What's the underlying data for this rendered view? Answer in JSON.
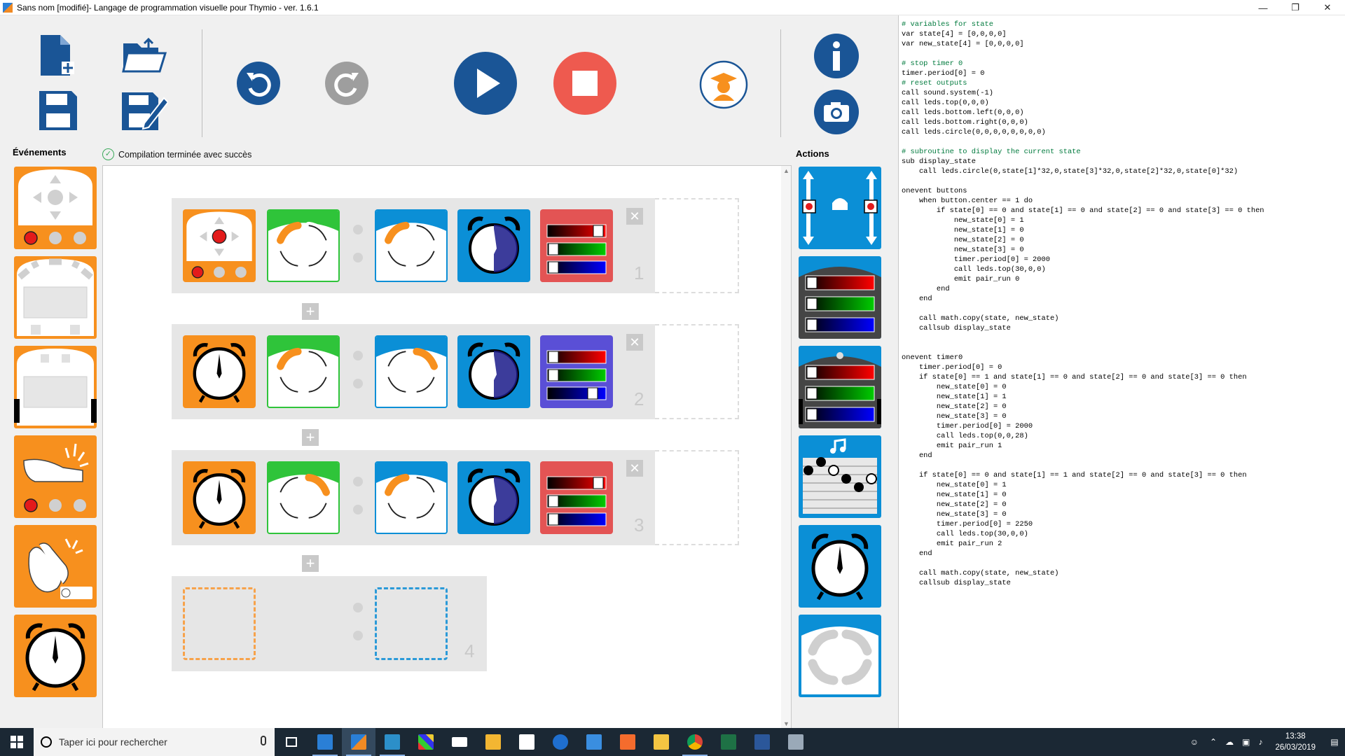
{
  "window": {
    "title": "Sans nom [modifié]- Langage de programmation visuelle pour Thymio - ver. 1.6.1",
    "controls": [
      "minimize",
      "maximize",
      "close"
    ]
  },
  "toolbar": {
    "buttons": [
      "new-file",
      "open-file",
      "save",
      "save-as",
      "undo",
      "redo",
      "run",
      "stop",
      "teacher-mode",
      "info",
      "screenshot"
    ],
    "colors": {
      "primary": "#1a5596",
      "stop": "#ee5a4f",
      "redo_disabled": "#9e9e9e",
      "teacher": "#f7901e"
    }
  },
  "events_label": "Événements",
  "actions_label": "Actions",
  "status_text": "Compilation terminée avec succès",
  "events": [
    "buttons-event",
    "front-proximity-event",
    "ground-proximity-event",
    "tap-event",
    "clap-event",
    "timer-event"
  ],
  "actions": [
    "motors-action",
    "top-color-action",
    "bottom-color-action",
    "music-action",
    "timer-action",
    "state-action"
  ],
  "rows": [
    {
      "number": "1",
      "event": "buttons",
      "state": [
        "on",
        "off",
        "off",
        "off"
      ],
      "new_state": [
        "on",
        "off",
        "off",
        "off"
      ],
      "color": "red"
    },
    {
      "number": "2",
      "event": "timer",
      "state": [
        "on",
        "off",
        "off",
        "off"
      ],
      "new_state": [
        "off",
        "on",
        "off",
        "off"
      ],
      "color": "blue"
    },
    {
      "number": "3",
      "event": "timer",
      "state": [
        "off",
        "on",
        "off",
        "off"
      ],
      "new_state": [
        "on",
        "off",
        "off",
        "off"
      ],
      "color": "red"
    },
    {
      "number": "4",
      "event": "empty"
    }
  ],
  "code_lines": [
    {
      "t": "# variables for state",
      "c": "com"
    },
    {
      "t": "var state[4] = [0,0,0,0]",
      "c": "kw"
    },
    {
      "t": "var new_state[4] = [0,0,0,0]",
      "c": "kw"
    },
    {
      "t": "",
      "c": ""
    },
    {
      "t": "# stop timer 0",
      "c": "com"
    },
    {
      "t": "timer.period[0] = 0",
      "c": ""
    },
    {
      "t": "# reset outputs",
      "c": "com"
    },
    {
      "t": "call sound.system(-1)",
      "c": "kw"
    },
    {
      "t": "call leds.top(0,0,0)",
      "c": "kw"
    },
    {
      "t": "call leds.bottom.left(0,0,0)",
      "c": "kw"
    },
    {
      "t": "call leds.bottom.right(0,0,0)",
      "c": "kw"
    },
    {
      "t": "call leds.circle(0,0,0,0,0,0,0,0)",
      "c": "kw"
    },
    {
      "t": "",
      "c": ""
    },
    {
      "t": "# subroutine to display the current state",
      "c": "com"
    },
    {
      "t": "sub display_state",
      "c": "kw"
    },
    {
      "t": "    call leds.circle(0,state[1]*32,0,state[3]*32,0,state[2]*32,0,state[0]*32)",
      "c": "kw"
    },
    {
      "t": "",
      "c": ""
    },
    {
      "t": "onevent buttons",
      "c": "kw"
    },
    {
      "t": "    when button.center == 1 do",
      "c": "kw"
    },
    {
      "t": "        if state[0] == 0 and state[1] == 0 and state[2] == 0 and state[3] == 0 then",
      "c": "kw"
    },
    {
      "t": "            new_state[0] = 1",
      "c": ""
    },
    {
      "t": "            new_state[1] = 0",
      "c": ""
    },
    {
      "t": "            new_state[2] = 0",
      "c": ""
    },
    {
      "t": "            new_state[3] = 0",
      "c": ""
    },
    {
      "t": "            timer.period[0] = 2000",
      "c": ""
    },
    {
      "t": "            call leds.top(30,0,0)",
      "c": "kw"
    },
    {
      "t": "            emit pair_run 0",
      "c": "kw"
    },
    {
      "t": "        end",
      "c": "kw"
    },
    {
      "t": "    end",
      "c": "kw"
    },
    {
      "t": "",
      "c": ""
    },
    {
      "t": "    call math.copy(state, new_state)",
      "c": "kw"
    },
    {
      "t": "    callsub display_state",
      "c": "kw"
    },
    {
      "t": "",
      "c": ""
    },
    {
      "t": "",
      "c": ""
    },
    {
      "t": "onevent timer0",
      "c": "kw"
    },
    {
      "t": "    timer.period[0] = 0",
      "c": ""
    },
    {
      "t": "    if state[0] == 1 and state[1] == 0 and state[2] == 0 and state[3] == 0 then",
      "c": "kw"
    },
    {
      "t": "        new_state[0] = 0",
      "c": ""
    },
    {
      "t": "        new_state[1] = 1",
      "c": ""
    },
    {
      "t": "        new_state[2] = 0",
      "c": ""
    },
    {
      "t": "        new_state[3] = 0",
      "c": ""
    },
    {
      "t": "        timer.period[0] = 2000",
      "c": ""
    },
    {
      "t": "        call leds.top(0,0,28)",
      "c": "kw"
    },
    {
      "t": "        emit pair_run 1",
      "c": "kw"
    },
    {
      "t": "    end",
      "c": "kw"
    },
    {
      "t": "",
      "c": ""
    },
    {
      "t": "    if state[0] == 0 and state[1] == 1 and state[2] == 0 and state[3] == 0 then",
      "c": "kw"
    },
    {
      "t": "        new_state[0] = 1",
      "c": ""
    },
    {
      "t": "        new_state[1] = 0",
      "c": ""
    },
    {
      "t": "        new_state[2] = 0",
      "c": ""
    },
    {
      "t": "        new_state[3] = 0",
      "c": ""
    },
    {
      "t": "        timer.period[0] = 2250",
      "c": ""
    },
    {
      "t": "        call leds.top(30,0,0)",
      "c": "kw"
    },
    {
      "t": "        emit pair_run 2",
      "c": "kw"
    },
    {
      "t": "    end",
      "c": "kw"
    },
    {
      "t": "",
      "c": ""
    },
    {
      "t": "    call math.copy(state, new_state)",
      "c": "kw"
    },
    {
      "t": "    callsub display_state",
      "c": "kw"
    }
  ],
  "taskbar": {
    "search_placeholder": "Taper ici pour rechercher",
    "apps": [
      "task-view",
      "thymio-app-1",
      "thymio-vpl",
      "thymio-app-3",
      "paint",
      "mail",
      "file-explorer-store",
      "store",
      "edge",
      "blue-app",
      "brave",
      "explorer",
      "chrome",
      "excel",
      "word",
      "other-app"
    ],
    "time": "13:38",
    "date": "26/03/2019"
  }
}
